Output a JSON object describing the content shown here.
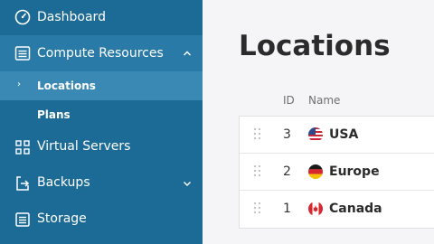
{
  "sidebar": {
    "items": [
      {
        "label": "Dashboard",
        "icon": "gauge-icon"
      },
      {
        "label": "Compute Resources",
        "icon": "list-icon",
        "expanded": true
      },
      {
        "label": "Virtual Servers",
        "icon": "server-icon"
      },
      {
        "label": "Backups",
        "icon": "backup-icon",
        "collapsible": true
      },
      {
        "label": "Storage",
        "icon": "storage-icon"
      }
    ],
    "subitems": [
      {
        "label": "Locations",
        "active": true
      },
      {
        "label": "Plans"
      }
    ],
    "colors": {
      "bg": "#1c6a96",
      "active": "#2a7aa7",
      "subactive": "#3a89b5"
    }
  },
  "main": {
    "title": "Locations",
    "columns": [
      "ID",
      "Name"
    ],
    "rows": [
      {
        "id": "3",
        "name": "USA",
        "flag": "us-flag-icon"
      },
      {
        "id": "2",
        "name": "Europe",
        "flag": "de-flag-icon"
      },
      {
        "id": "1",
        "name": "Canada",
        "flag": "ca-flag-icon"
      }
    ]
  }
}
